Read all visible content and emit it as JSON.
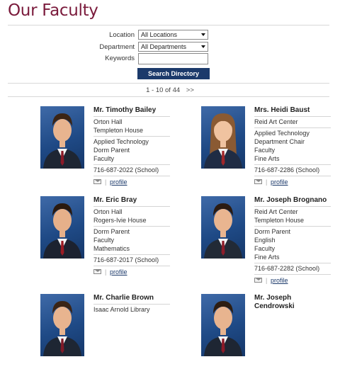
{
  "page": {
    "title": "Our Faculty"
  },
  "search": {
    "location_label": "Location",
    "location_value": "All Locations",
    "department_label": "Department",
    "department_value": "All Departments",
    "keywords_label": "Keywords",
    "keywords_value": "",
    "button_label": "Search Directory"
  },
  "pagination": {
    "range": "1 - 10 of 44",
    "next": ">>"
  },
  "faculty": [
    {
      "name": "Mr. Timothy Bailey",
      "group1": [
        "Orton Hall",
        "Templeton House"
      ],
      "group2": [
        "Applied Technology",
        "Dorm Parent",
        "Faculty"
      ],
      "phone": "716-687-2022 (School)",
      "profile": "profile"
    },
    {
      "name": "Mrs. Heidi Baust",
      "group1": [
        "Reid Art Center"
      ],
      "group2": [
        "Applied Technology",
        "Department Chair",
        "Faculty",
        "Fine Arts"
      ],
      "phone": "716-687-2286 (School)",
      "profile": "profile"
    },
    {
      "name": "Mr. Eric Bray",
      "group1": [
        "Orton Hall",
        "Rogers-Ivie House"
      ],
      "group2": [
        "Dorm Parent",
        "Faculty",
        "Mathematics"
      ],
      "phone": "716-687-2017 (School)",
      "profile": "profile"
    },
    {
      "name": "Mr. Joseph Brognano",
      "group1": [
        "Reid Art Center",
        "Templeton House"
      ],
      "group2": [
        "Dorm Parent",
        "English",
        "Faculty",
        "Fine Arts"
      ],
      "phone": "716-687-2282 (School)",
      "profile": "profile"
    },
    {
      "name": "Mr. Charlie Brown",
      "group1": [
        "Isaac Arnold Library"
      ],
      "group2": [],
      "phone": "",
      "profile": ""
    },
    {
      "name": "Mr. Joseph Cendrowski",
      "group1": [],
      "group2": [],
      "phone": "",
      "profile": ""
    }
  ]
}
